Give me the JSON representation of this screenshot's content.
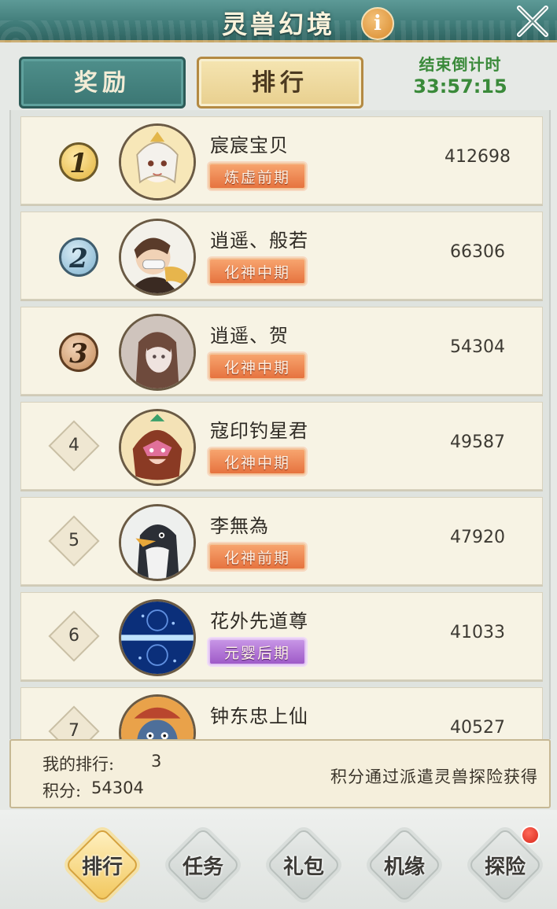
{
  "header": {
    "title": "灵兽幻境",
    "info_label": "i"
  },
  "tabs": {
    "rewards": "奖励",
    "ranking": "排行",
    "active": "ranking"
  },
  "countdown": {
    "label": "结束倒计时",
    "value": "33:57:15"
  },
  "ranking": [
    {
      "rank": "1",
      "name": "宸宸宝贝",
      "realm": "炼虚前期",
      "realm_color": "orange",
      "score": "412698"
    },
    {
      "rank": "2",
      "name": "逍遥、般若",
      "realm": "化神中期",
      "realm_color": "orange",
      "score": "66306"
    },
    {
      "rank": "3",
      "name": "逍遥、贺",
      "realm": "化神中期",
      "realm_color": "orange",
      "score": "54304"
    },
    {
      "rank": "4",
      "name": "寇印钓星君",
      "realm": "化神中期",
      "realm_color": "orange",
      "score": "49587"
    },
    {
      "rank": "5",
      "name": "李無為",
      "realm": "化神前期",
      "realm_color": "orange",
      "score": "47920"
    },
    {
      "rank": "6",
      "name": "花外先道尊",
      "realm": "元婴后期",
      "realm_color": "purple",
      "score": "41033"
    },
    {
      "rank": "7",
      "name": "钟东忠上仙",
      "realm": "",
      "realm_color": "orange",
      "score": "40527"
    }
  ],
  "my_rank": {
    "rank_label": "我的排行:",
    "rank_value": "3",
    "score_label": "积分:",
    "score_value": "54304",
    "hint": "积分通过派遣灵兽探险获得"
  },
  "bottom_nav": [
    {
      "label": "排行",
      "active": true,
      "badge": false
    },
    {
      "label": "任务",
      "active": false,
      "badge": false
    },
    {
      "label": "礼包",
      "active": false,
      "badge": false
    },
    {
      "label": "机缘",
      "active": false,
      "badge": false
    },
    {
      "label": "探险",
      "active": false,
      "badge": true
    }
  ],
  "colors": {
    "header_teal": "#3f7b78",
    "accent_gold": "#e8cf8e",
    "countdown_green": "#3a8a3a",
    "realm_orange": "#e6733f",
    "realm_purple": "#9e5ac8",
    "badge_red": "#d8291c"
  }
}
